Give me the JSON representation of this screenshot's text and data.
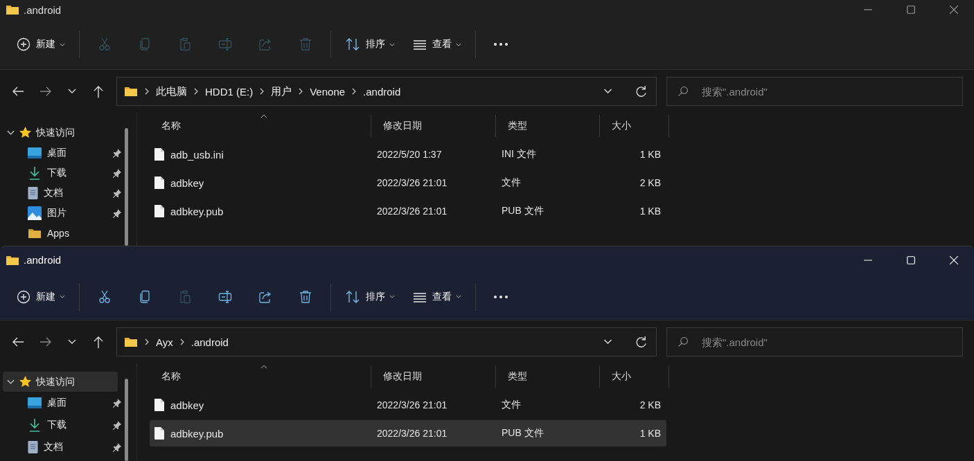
{
  "windows": [
    {
      "title": ".android",
      "active": false,
      "toolbar": [
        {
          "kind": "new",
          "label": "新建",
          "disabled": false
        },
        {
          "kind": "cut",
          "disabled": true
        },
        {
          "kind": "copy",
          "disabled": true
        },
        {
          "kind": "paste",
          "disabled": true
        },
        {
          "kind": "rename",
          "disabled": true
        },
        {
          "kind": "share",
          "disabled": true
        },
        {
          "kind": "delete",
          "disabled": true
        },
        {
          "kind": "sort",
          "label": "排序",
          "disabled": false
        },
        {
          "kind": "view",
          "label": "查看",
          "disabled": false
        },
        {
          "kind": "more",
          "disabled": false
        }
      ],
      "path": [
        "此电脑",
        "HDD1 (E:)",
        "用户",
        "Venone",
        ".android"
      ],
      "search": {
        "placeholder": "搜索\".android\""
      },
      "sidebar": [
        {
          "label": "快速访问",
          "expanded": true,
          "selected": false,
          "children": [
            {
              "kind": "desktop",
              "label": "桌面",
              "pinned": true
            },
            {
              "kind": "download",
              "label": "下载",
              "pinned": true
            },
            {
              "kind": "document",
              "label": "文档",
              "pinned": true
            },
            {
              "kind": "image",
              "label": "图片",
              "pinned": true
            },
            {
              "kind": "folder",
              "label": "Apps",
              "pinned": false
            }
          ]
        }
      ],
      "columns": [
        "名称",
        "修改日期",
        "类型",
        "大小"
      ],
      "rows": [
        {
          "name": "adb_usb.ini",
          "date": "2022/5/20 1:37",
          "type": "INI 文件",
          "size": "1 KB",
          "selected": false
        },
        {
          "name": "adbkey",
          "date": "2022/3/26 21:01",
          "type": "文件",
          "size": "2 KB",
          "selected": false
        },
        {
          "name": "adbkey.pub",
          "date": "2022/3/26 21:01",
          "type": "PUB 文件",
          "size": "1 KB",
          "selected": false
        }
      ]
    },
    {
      "title": ".android",
      "active": true,
      "toolbar": [
        {
          "kind": "new",
          "label": "新建",
          "disabled": false
        },
        {
          "kind": "cut",
          "disabled": false
        },
        {
          "kind": "copy",
          "disabled": false
        },
        {
          "kind": "paste",
          "disabled": true
        },
        {
          "kind": "rename",
          "disabled": false
        },
        {
          "kind": "share",
          "disabled": false
        },
        {
          "kind": "delete",
          "disabled": false
        },
        {
          "kind": "sort",
          "label": "排序",
          "disabled": false
        },
        {
          "kind": "view",
          "label": "查看",
          "disabled": false
        },
        {
          "kind": "more",
          "disabled": false
        }
      ],
      "path": [
        "Ayx",
        ".android"
      ],
      "search": {
        "placeholder": "搜索\".android\""
      },
      "sidebar": [
        {
          "label": "快速访问",
          "expanded": true,
          "selected": true,
          "children": [
            {
              "kind": "desktop",
              "label": "桌面",
              "pinned": true
            },
            {
              "kind": "download",
              "label": "下载",
              "pinned": true
            },
            {
              "kind": "document",
              "label": "文档",
              "pinned": true
            }
          ]
        }
      ],
      "columns": [
        "名称",
        "修改日期",
        "类型",
        "大小"
      ],
      "rows": [
        {
          "name": "adbkey",
          "date": "2022/3/26 21:01",
          "type": "文件",
          "size": "2 KB",
          "selected": false
        },
        {
          "name": "adbkey.pub",
          "date": "2022/3/26 21:01",
          "type": "PUB 文件",
          "size": "1 KB",
          "selected": true
        }
      ]
    }
  ]
}
